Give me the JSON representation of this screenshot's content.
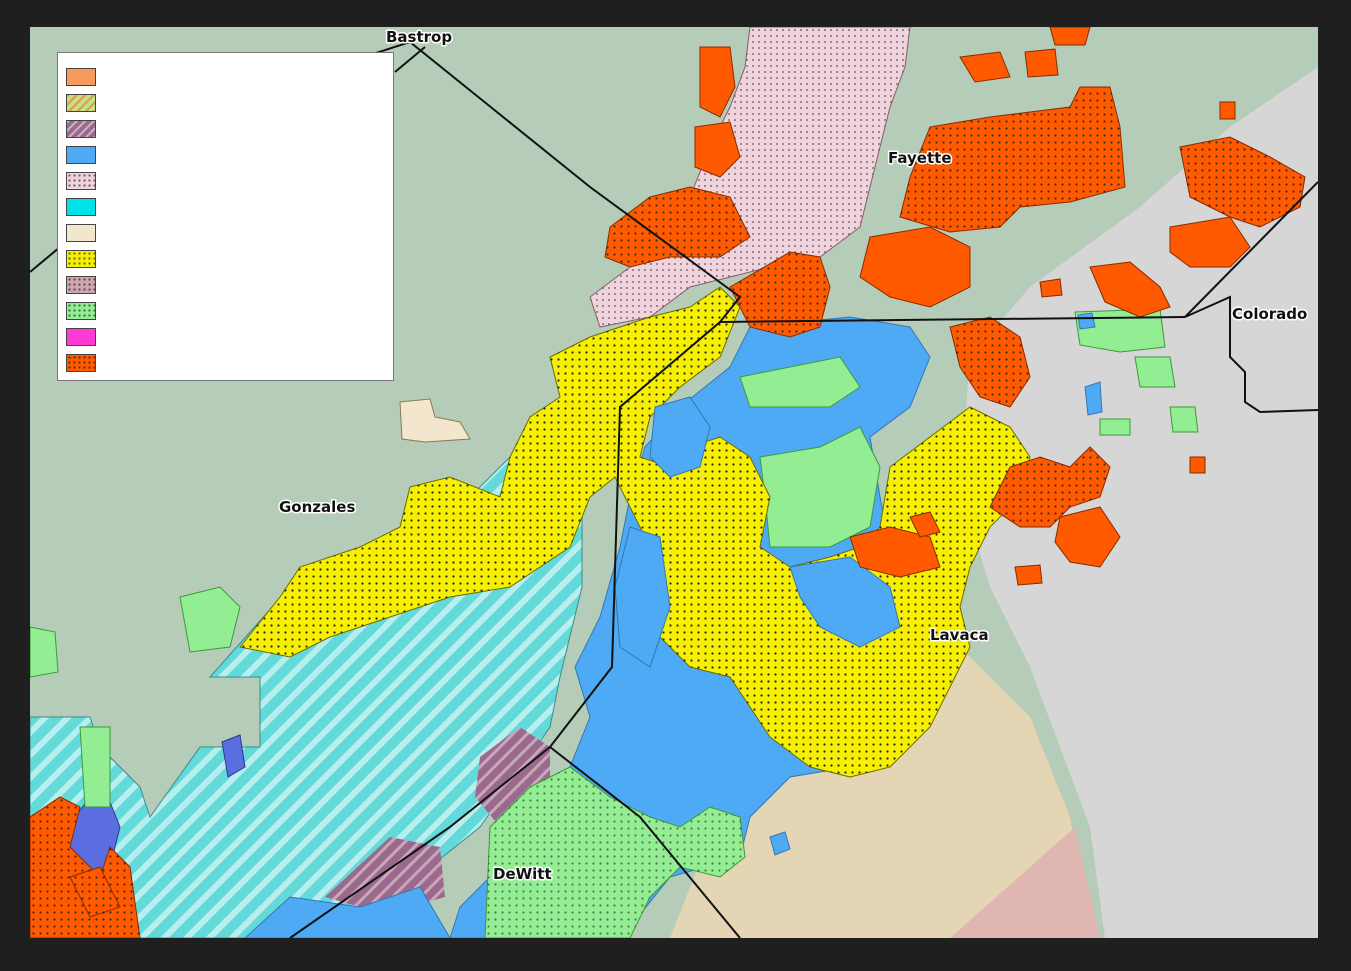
{
  "map": {
    "county_labels": {
      "bastrop": "Bastrop",
      "fayette": "Fayette",
      "colorado": "Colorado",
      "gonzales": "Gonzales",
      "lavaca": "Lavaca",
      "dewitt": "DeWitt"
    },
    "colors": {
      "background_green": "#b5cdb8",
      "background_gray": "#d6d6d6",
      "background_tan": "#e4d6b4",
      "background_pink": "#e0b6b2",
      "county_line": "#111111"
    }
  },
  "legend": {
    "items": [
      {
        "fill": "#f79a5c",
        "pattern": "solid"
      },
      {
        "fill": "#c4e08a",
        "pattern": "hatch-orange"
      },
      {
        "fill": "#9a6a8e",
        "pattern": "hatch-mauve"
      },
      {
        "fill": "#4eaaf5",
        "pattern": "solid"
      },
      {
        "fill": "#efd3dd",
        "pattern": "dots"
      },
      {
        "fill": "#00e3e6",
        "pattern": "solid"
      },
      {
        "fill": "#f2e6cc",
        "pattern": "solid"
      },
      {
        "fill": "#f6f000",
        "pattern": "dots"
      },
      {
        "fill": "#cfa6ad",
        "pattern": "dots"
      },
      {
        "fill": "#93ee93",
        "pattern": "dots"
      },
      {
        "fill": "#ff3bd6",
        "pattern": "solid"
      },
      {
        "fill": "#ff5a00",
        "pattern": "dots"
      }
    ]
  }
}
